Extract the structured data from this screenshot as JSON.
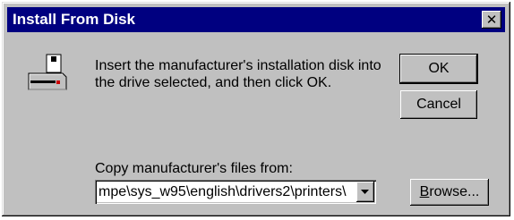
{
  "window": {
    "title": "Install From Disk",
    "close_icon": "close-icon"
  },
  "message": {
    "line1": "Insert the manufacturer's installation disk into",
    "line2": "the drive selected, and then click OK."
  },
  "buttons": {
    "ok_label": "OK",
    "cancel_label": "Cancel",
    "browse_label_underlined": "B",
    "browse_label_rest": "rowse..."
  },
  "copy_from": {
    "label": "Copy manufacturer's files from:",
    "value": "mpe\\sys_w95\\english\\drivers2\\printers\\"
  },
  "icons": {
    "disk_drive": "floppy-drive-icon",
    "dropdown": "chevron-down-icon"
  },
  "colors": {
    "titlebar": "#000080",
    "face": "#c0c0c0"
  }
}
